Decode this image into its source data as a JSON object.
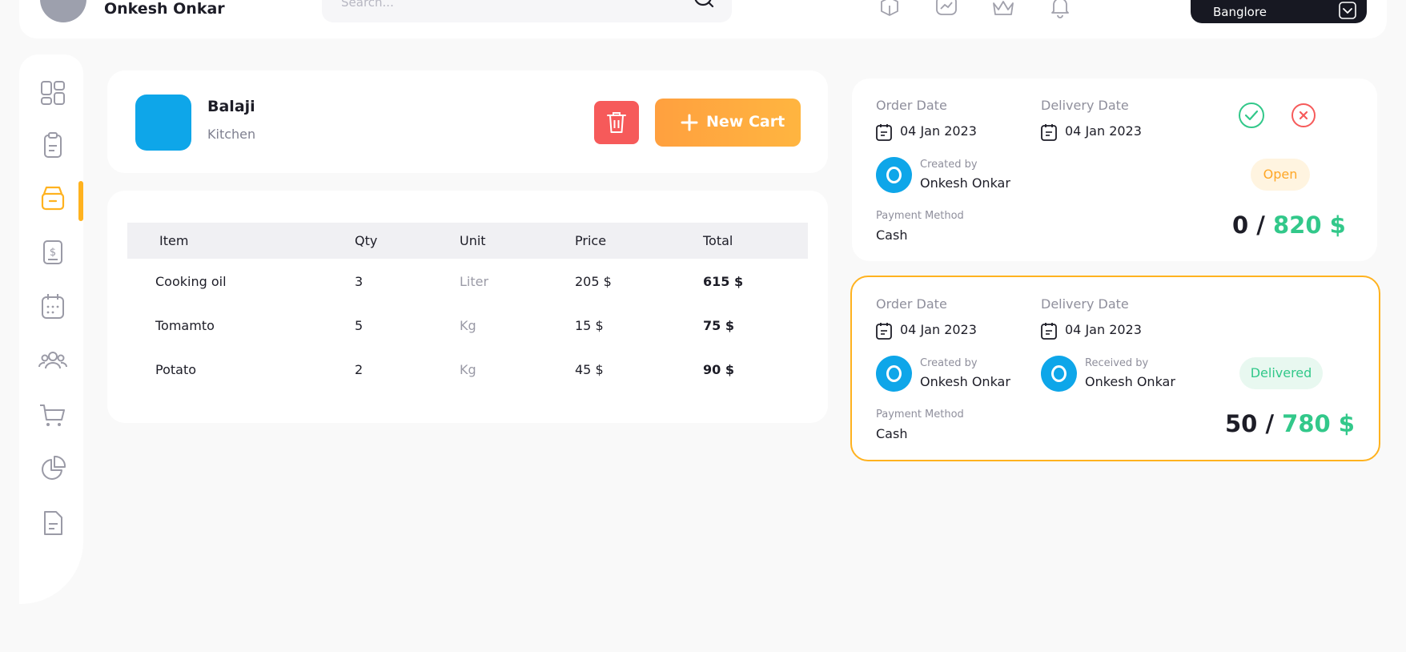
{
  "header": {
    "user_name": "Onkesh Onkar",
    "search_placeholder": "Search...",
    "location": "Banglore",
    "icons": [
      "box-icon",
      "chart-icon",
      "crown-icon",
      "bell-icon"
    ]
  },
  "sidebar": {
    "items": [
      {
        "name": "dashboard",
        "icon": "grid-icon"
      },
      {
        "name": "orders",
        "icon": "clipboard-icon"
      },
      {
        "name": "inventory",
        "icon": "archive-box-icon",
        "active": true
      },
      {
        "name": "billing",
        "icon": "dollar-icon"
      },
      {
        "name": "calendar",
        "icon": "calendar-icon"
      },
      {
        "name": "users",
        "icon": "users-icon"
      },
      {
        "name": "cart",
        "icon": "cart-icon"
      },
      {
        "name": "reports",
        "icon": "pie-chart-icon"
      },
      {
        "name": "documents",
        "icon": "document-icon"
      }
    ],
    "accent_color": "#ffb21f"
  },
  "shop": {
    "name": "Balaji",
    "subtitle": "Kitchen",
    "logo_color": "#0ea6e9",
    "new_cart_label": "New Cart"
  },
  "items_table": {
    "headers": [
      "Item",
      "Qty",
      "Unit",
      "Price",
      "Total"
    ],
    "rows": [
      {
        "item": "Cooking oil",
        "qty": "3",
        "unit": "Liter",
        "price": "205 $",
        "total": "615 $"
      },
      {
        "item": "Tomamto",
        "qty": "5",
        "unit": "Kg",
        "price": "15 $",
        "total": "75 $"
      },
      {
        "item": "Potato",
        "qty": "2",
        "unit": "Kg",
        "price": "45 $",
        "total": "90 $"
      }
    ]
  },
  "orders": [
    {
      "order_date_label": "Order Date",
      "order_date": "04 Jan 2023",
      "delivery_date_label": "Delivery Date",
      "delivery_date": "04 Jan 2023",
      "created_by_label": "Created by",
      "created_by": "Onkesh Onkar",
      "payment_method_label": "Payment Method",
      "payment_method": "Cash",
      "status": "Open",
      "paid": "0",
      "separator": " / ",
      "total": "820 $"
    },
    {
      "order_date_label": "Order Date",
      "order_date": "04 Jan 2023",
      "delivery_date_label": "Delivery Date",
      "delivery_date": "04 Jan 2023",
      "created_by_label": "Created by",
      "created_by": "Onkesh Onkar",
      "received_by_label": "Received by",
      "received_by": "Onkesh Onkar",
      "payment_method_label": "Payment Method",
      "payment_method": "Cash",
      "status": "Delivered",
      "paid": "50",
      "separator": " / ",
      "total": "780 $"
    }
  ],
  "colors": {
    "primary_dark": "#171822",
    "orange": "#ffa03f",
    "red": "#f65a5a",
    "green": "#32c88a",
    "blue": "#0ea6e9"
  }
}
